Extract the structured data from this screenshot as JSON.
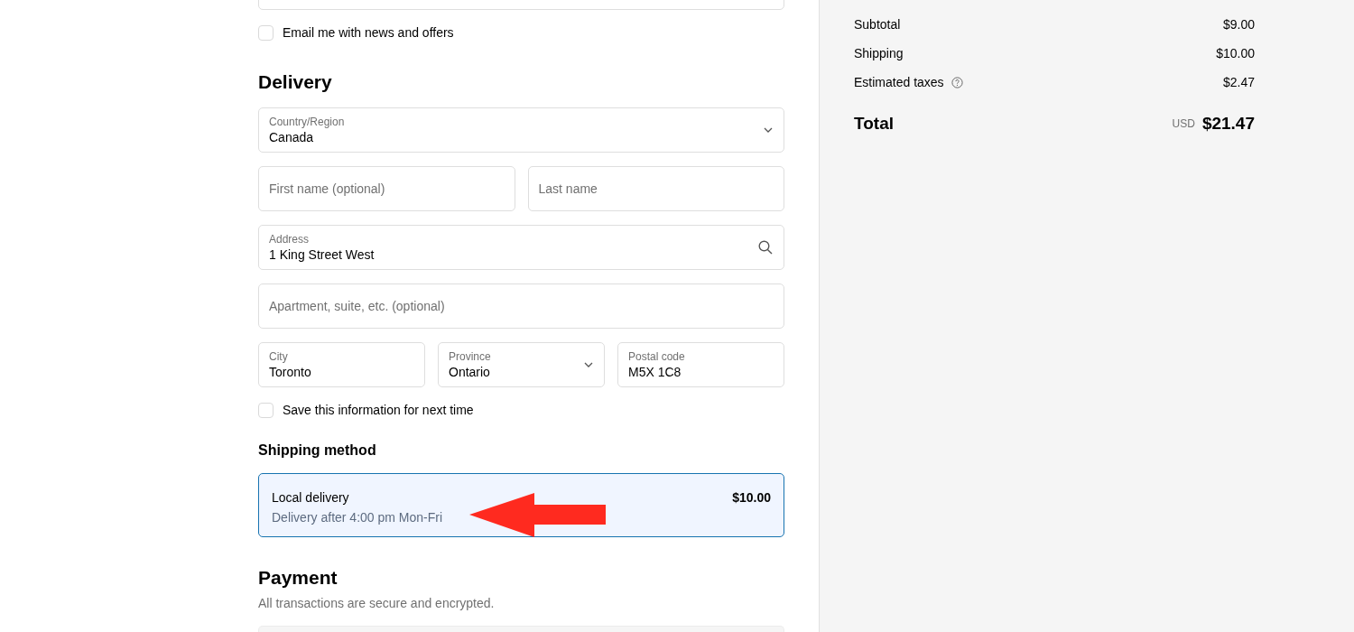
{
  "newsletter": {
    "label": "Email me with news and offers",
    "checked": false
  },
  "delivery": {
    "heading": "Delivery",
    "rows": [
      [
        {
          "kind": "select",
          "label": "Country/Region",
          "value": "Canada"
        }
      ],
      [
        {
          "kind": "text",
          "placeholder": "First name (optional)"
        },
        {
          "kind": "text",
          "placeholder": "Last name"
        }
      ],
      [
        {
          "kind": "search",
          "label": "Address",
          "value": "1 King Street West"
        }
      ],
      [
        {
          "kind": "text",
          "placeholder": "Apartment, suite, etc. (optional)"
        }
      ],
      [
        {
          "kind": "text",
          "label": "City",
          "value": "Toronto"
        },
        {
          "kind": "select",
          "label": "Province",
          "value": "Ontario"
        },
        {
          "kind": "text",
          "label": "Postal code",
          "value": "M5X 1C8"
        }
      ]
    ]
  },
  "save_info": {
    "label": "Save this information for next time",
    "checked": false
  },
  "shipping_method": {
    "heading": "Shipping method",
    "options": [
      {
        "name": "Local delivery",
        "detail": "Delivery after 4:00 pm Mon-Fri",
        "price": "$10.00",
        "selected": true
      }
    ]
  },
  "payment": {
    "heading": "Payment",
    "note": "All transactions are secure and encrypted."
  },
  "summary": {
    "lines": [
      {
        "label": "Subtotal",
        "value": "$9.00",
        "info": false
      },
      {
        "label": "Shipping",
        "value": "$10.00",
        "info": false
      },
      {
        "label": "Estimated taxes",
        "value": "$2.47",
        "info": true
      }
    ],
    "total": {
      "label": "Total",
      "currency": "USD",
      "value": "$21.47"
    }
  }
}
